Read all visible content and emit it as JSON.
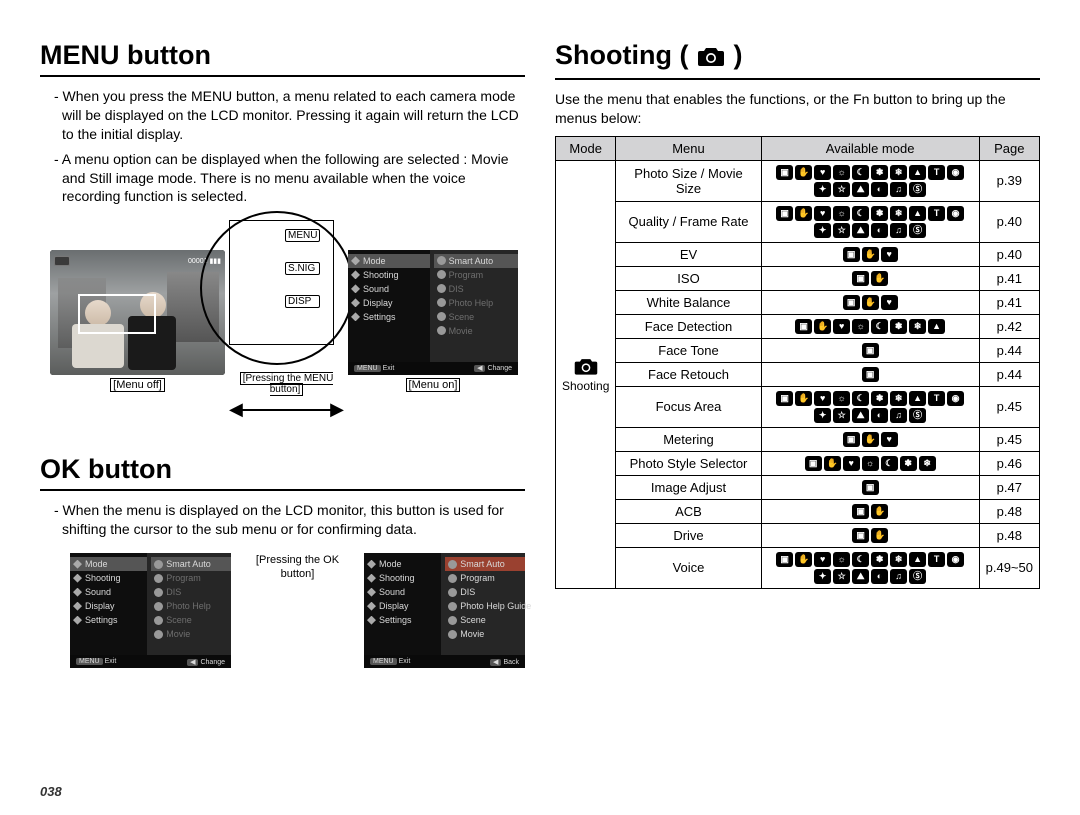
{
  "page_number": "038",
  "left": {
    "section1": {
      "title": "MENU button",
      "p1": "- When you press the MENU button, a menu related to each camera mode will be displayed on the LCD monitor. Pressing it again will return the LCD to the initial display.",
      "p2": "- A menu option can be displayed when the following are selected : Movie and Still image mode. There is no menu available when the voice recording function is selected.",
      "fig_menu_off": "[Menu off]",
      "fig_menu_on": "[Menu on]",
      "fig_pressing": "[Pressing the MENU button]",
      "dial_label_top": "MENU",
      "dial_label_mid": "S.NIG",
      "dial_label_bot": "DISP",
      "menu_left": [
        "Mode",
        "Shooting",
        "Sound",
        "Display",
        "Settings"
      ],
      "menu_right": [
        "Smart Auto",
        "Program",
        "DIS",
        "Photo Help",
        "Scene",
        "Movie"
      ],
      "menu_footer_left_key": "MENU",
      "menu_footer_left": "Exit",
      "menu_footer_right_key": "▶",
      "menu_footer_right": "Change"
    },
    "section2": {
      "title": "OK button",
      "p1": "- When the menu is displayed on the LCD monitor, this button is used for shifting the cursor to the sub menu or for confirming data.",
      "fig_pressing": "[Pressing the OK button]",
      "scr1_left": [
        "Mode",
        "Shooting",
        "Sound",
        "Display",
        "Settings"
      ],
      "scr1_right": [
        "Smart Auto",
        "Program",
        "DIS",
        "Photo Help",
        "Scene",
        "Movie"
      ],
      "scr1_footer_left": "Exit",
      "scr1_footer_right": "Change",
      "scr2_left": [
        "Mode",
        "Shooting",
        "Sound",
        "Display",
        "Settings"
      ],
      "scr2_right": [
        "Smart Auto",
        "Program",
        "DIS",
        "Photo Help Guide",
        "Scene",
        "Movie"
      ],
      "scr2_footer_left": "Exit",
      "scr2_footer_right": "Back"
    }
  },
  "right": {
    "title": "Shooting (",
    "title_close": ")",
    "intro": "Use the menu that enables the functions, or the Fn button to bring up the menus below:",
    "table": {
      "headers": {
        "mode": "Mode",
        "menu": "Menu",
        "avail": "Available mode",
        "page": "Page"
      },
      "mode_cell": "Shooting",
      "rows": [
        {
          "menu": "Photo Size / Movie Size",
          "icons": 16,
          "page": "p.39"
        },
        {
          "menu": "Quality / Frame Rate",
          "icons": 16,
          "page": "p.40"
        },
        {
          "menu": "EV",
          "icons": 3,
          "page": "p.40"
        },
        {
          "menu": "ISO",
          "icons": 2,
          "page": "p.41"
        },
        {
          "menu": "White Balance",
          "icons": 3,
          "page": "p.41"
        },
        {
          "menu": "Face Detection",
          "icons": 8,
          "page": "p.42"
        },
        {
          "menu": "Face Tone",
          "icons": 1,
          "page": "p.44"
        },
        {
          "menu": "Face Retouch",
          "icons": 1,
          "page": "p.44"
        },
        {
          "menu": "Focus Area",
          "icons": 16,
          "page": "p.45"
        },
        {
          "menu": "Metering",
          "icons": 3,
          "page": "p.45"
        },
        {
          "menu": "Photo Style Selector",
          "icons": 7,
          "page": "p.46"
        },
        {
          "menu": "Image Adjust",
          "icons": 1,
          "page": "p.47"
        },
        {
          "menu": "ACB",
          "icons": 2,
          "page": "p.48"
        },
        {
          "menu": "Drive",
          "icons": 2,
          "page": "p.48"
        },
        {
          "menu": "Voice",
          "icons": 16,
          "page": "p.49~50"
        }
      ]
    }
  },
  "micon_glyphs": [
    "▣",
    "✋",
    "♥",
    "☼",
    "☾",
    "✽",
    "❄",
    "▲",
    "T",
    "◉",
    "✦",
    "☆",
    "⛰",
    "◐",
    "♫",
    "Ⓢ",
    "▶",
    "◎"
  ]
}
